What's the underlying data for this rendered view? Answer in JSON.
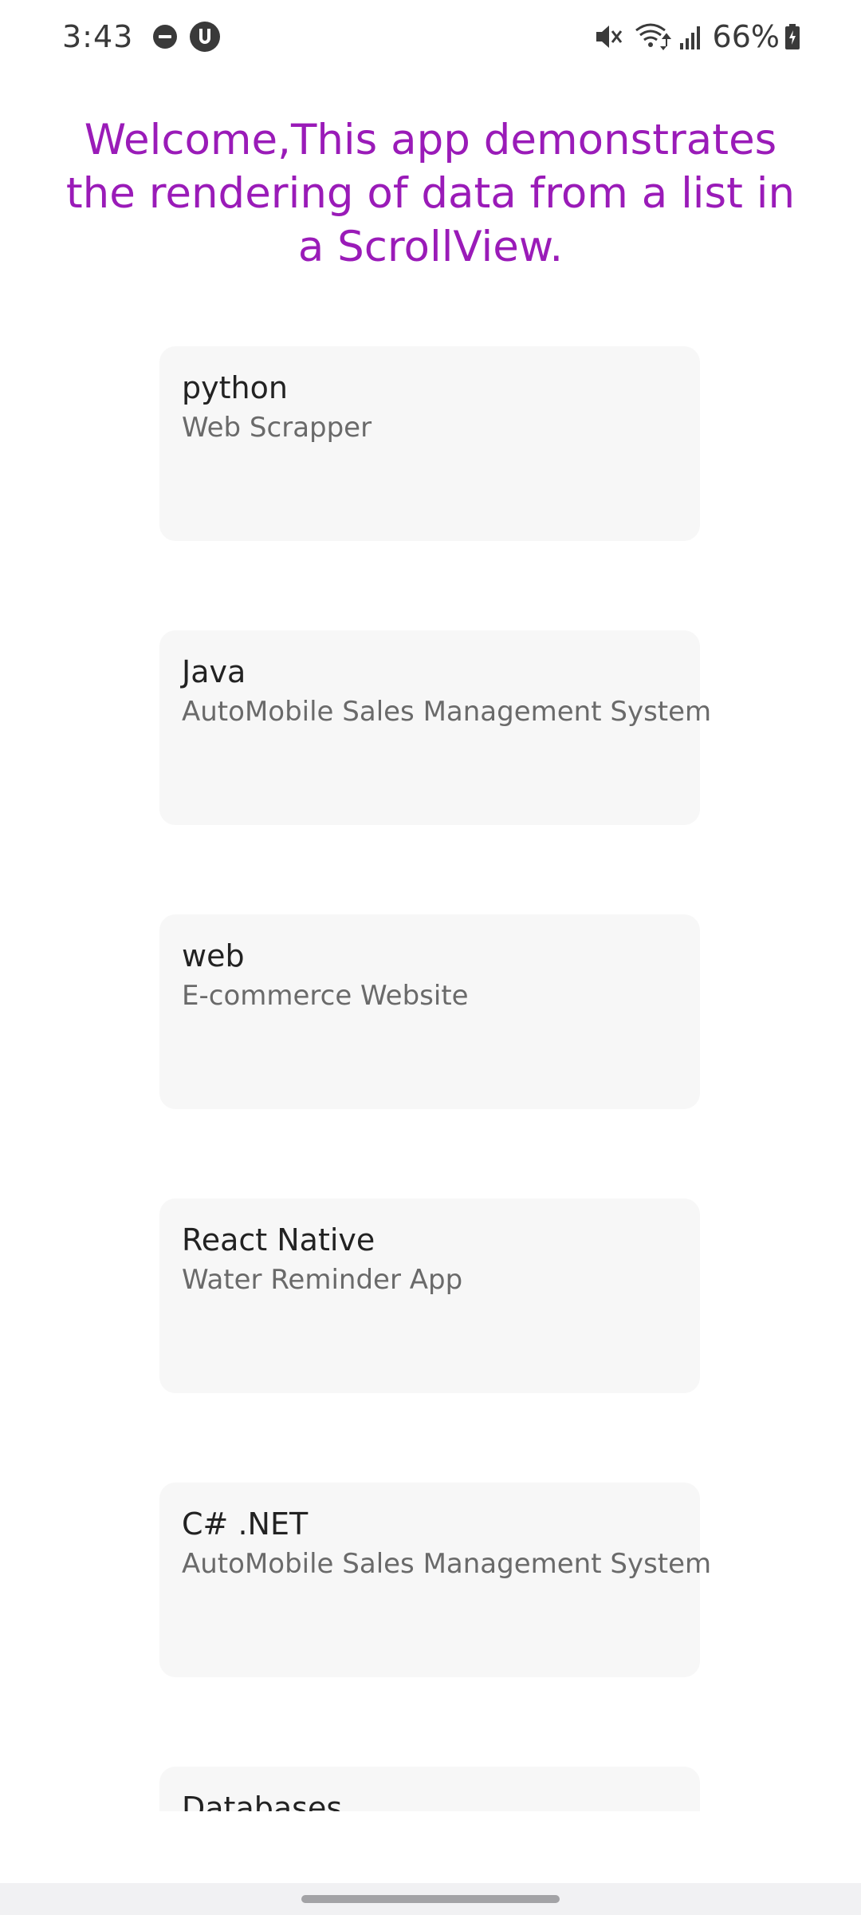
{
  "status_bar": {
    "time": "3:43",
    "battery": "66%",
    "icons": [
      "do-not-disturb-icon",
      "vpn-icon",
      "mute-icon",
      "wifi-icon",
      "signal-icon",
      "battery-icon"
    ]
  },
  "heading": "Welcome,This app demonstrates the rendering of data from a list in a ScrollView.",
  "colors": {
    "heading": "#9a1bb8",
    "card_background": "#f7f7f7",
    "title_text": "#222222",
    "subtitle_text": "#6a6a6a"
  },
  "items": [
    {
      "title": "python",
      "subtitle": "Web Scrapper"
    },
    {
      "title": "Java",
      "subtitle": "AutoMobile Sales Management System"
    },
    {
      "title": "web",
      "subtitle": "E-commerce Website"
    },
    {
      "title": "React Native",
      "subtitle": "Water Reminder App"
    },
    {
      "title": "C# .NET",
      "subtitle": "AutoMobile Sales Management System"
    },
    {
      "title": "Databases",
      "subtitle": ""
    }
  ]
}
